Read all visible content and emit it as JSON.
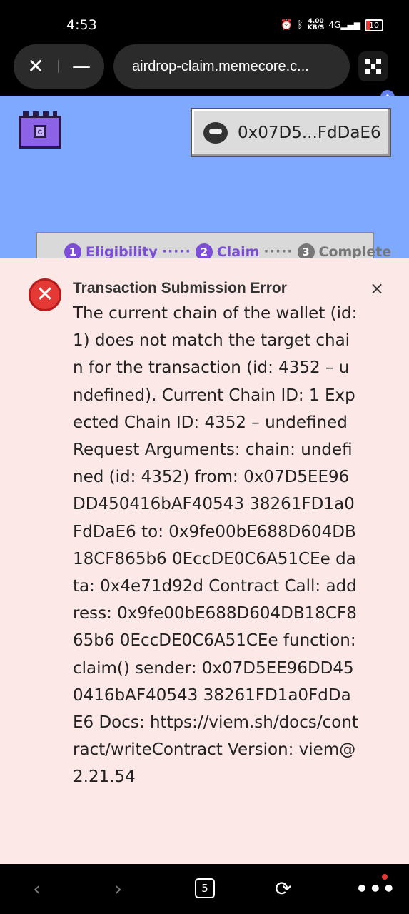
{
  "status_bar": {
    "time": "4:53",
    "net_speed_top": "4.00",
    "net_speed_bottom": "KB/S",
    "signal_label": "4G",
    "battery": "10"
  },
  "browser": {
    "url": "airdrop-claim.memecore.c...",
    "close_icon": "close-icon",
    "minimize_icon": "minimize-icon"
  },
  "page": {
    "wallet_address": "0x07D5...FdDaE6",
    "steps": [
      {
        "number": "1",
        "label": "Eligibility"
      },
      {
        "number": "2",
        "label": "Claim"
      },
      {
        "number": "3",
        "label": "Complete"
      }
    ],
    "step_dots": "·····"
  },
  "error_toast": {
    "title": "Transaction Submission Error",
    "close_label": "×",
    "message": "The current chain of the wallet (id: 1) does not match the target chain for the transaction (id: 4352 – undefined). Current Chain ID: 1 Expected Chain ID: 4352 – undefined Request Arguments: chain: undefined (id: 4352) from: 0x07D5EE96DD450416bAF40543 38261FD1a0FdDaE6 to: 0x9fe00bE688D604DB18CF865b6 0EccDE0C6A51CEe data: 0x4e71d92d Contract Call: address: 0x9fe00bE688D604DB18CF865b6 0EccDE0C6A51CEe function: claim() sender: 0x07D5EE96DD450416bAF40543 38261FD1a0FdDaE6 Docs: https://viem.sh/docs/contract/writeContract Version: viem@2.21.54"
  },
  "nav_bar": {
    "tab_count": "5"
  },
  "colors": {
    "page_background": "#7ea9ff",
    "toast_background": "#fde8e8",
    "accent_purple": "#7c4dd6",
    "error_red": "#e53935"
  }
}
